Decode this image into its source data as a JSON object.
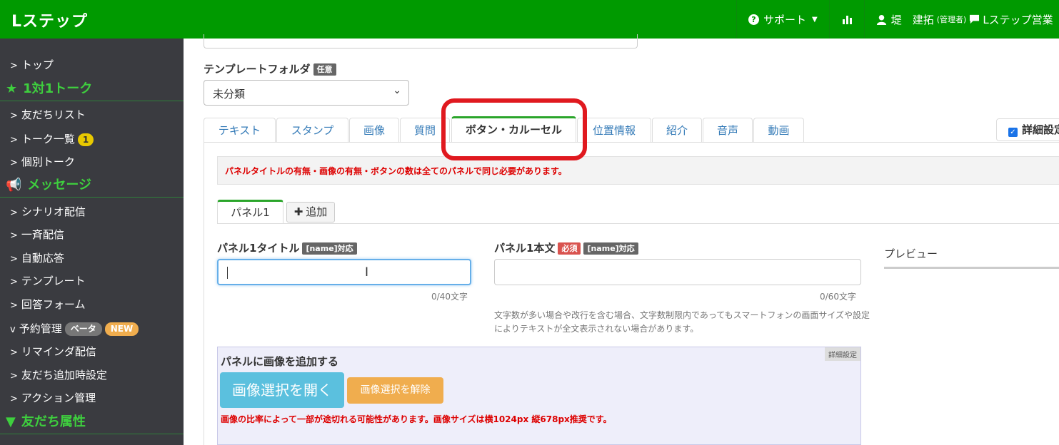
{
  "app": {
    "brand": "Lステップ"
  },
  "topnav": {
    "support": "サポート",
    "user_name": "堤　建拓",
    "user_role": "(管理者)",
    "account": "Lステップ営業"
  },
  "sidebar": {
    "top": "トップ",
    "sec_talk": "1対1トーク",
    "friends_list": "友だちリスト",
    "talk_list": "トーク一覧",
    "talk_badge": "1",
    "individual_talk": "個別トーク",
    "sec_message": "メッセージ",
    "scenario": "シナリオ配信",
    "broadcast": "一斉配信",
    "auto_reply": "自動応答",
    "template": "テンプレート",
    "answer_form": "回答フォーム",
    "reservation": "予約管理",
    "beta_badge": "ベータ",
    "new_badge": "NEW",
    "reminder": "リマインダ配信",
    "friend_add_settings": "友だち追加時設定",
    "action_mgmt": "アクション管理",
    "sec_attributes": "友だち属性"
  },
  "form": {
    "folder_label": "テンプレートフォルダ",
    "optional_tag": "任意",
    "folder_value": "未分類",
    "tabs": [
      "テキスト",
      "スタンプ",
      "画像",
      "質問",
      "ボタン・カルーセル",
      "位置情報",
      "紹介",
      "音声",
      "動画"
    ],
    "advanced_setting": "詳細設定",
    "alert": "パネルタイトルの有無・画像の有無・ボタンの数は全てのパネルで同じ必要があります。",
    "panel_tab": "パネル1",
    "add_tab": "追加",
    "title_label": "パネル1タイトル",
    "name_tag": "[name]対応",
    "body_label": "パネル1本文",
    "required_tag": "必須",
    "title_count": "0/40文字",
    "body_count": "0/60文字",
    "body_help": "文字数が多い場合や改行を含む場合、文字数制限内であってもスマートフォンの画面サイズや設定によりテキストが全文表示されない場合があります。",
    "preview": "プレビュー",
    "image_section_title": "パネルに画像を追加する",
    "image_adv": "詳細設定",
    "open_image": "画像選択を開く",
    "clear_image": "画像選択を解除",
    "image_warning": "画像の比率によって一部が途切れる可能性があります。画像サイズは横1024px 縦678px推奨です。"
  }
}
